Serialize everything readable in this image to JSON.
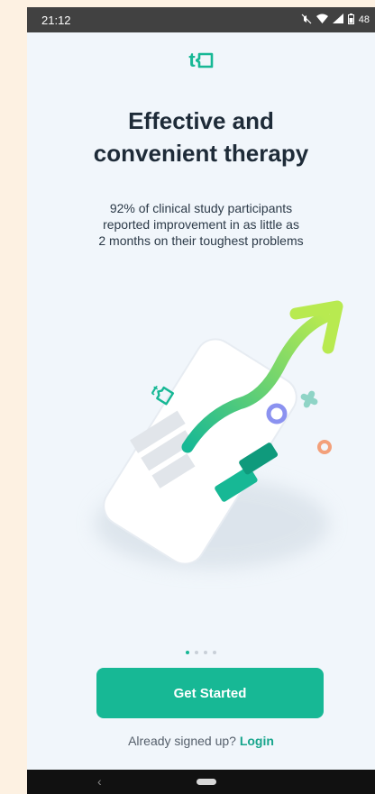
{
  "status_bar": {
    "time": "21:12",
    "battery_text": "48",
    "icons": [
      "mute-icon",
      "wifi-icon",
      "signal-icon",
      "battery-icon"
    ]
  },
  "brand": {
    "logo_letter": "t"
  },
  "headline": {
    "line1": "Effective and",
    "line2": "convenient therapy"
  },
  "subtitle": {
    "line1": "92% of clinical study participants",
    "line2": "reported improvement in as little as",
    "line3": "2 months on their toughest problems"
  },
  "pager": {
    "count": 4,
    "active": 0
  },
  "cta": {
    "label": "Get Started"
  },
  "login": {
    "prompt": "Already signed up?",
    "link": "Login"
  },
  "colors": {
    "accent": "#17b895",
    "headline": "#1e2b38",
    "background": "#f1f6fb"
  }
}
